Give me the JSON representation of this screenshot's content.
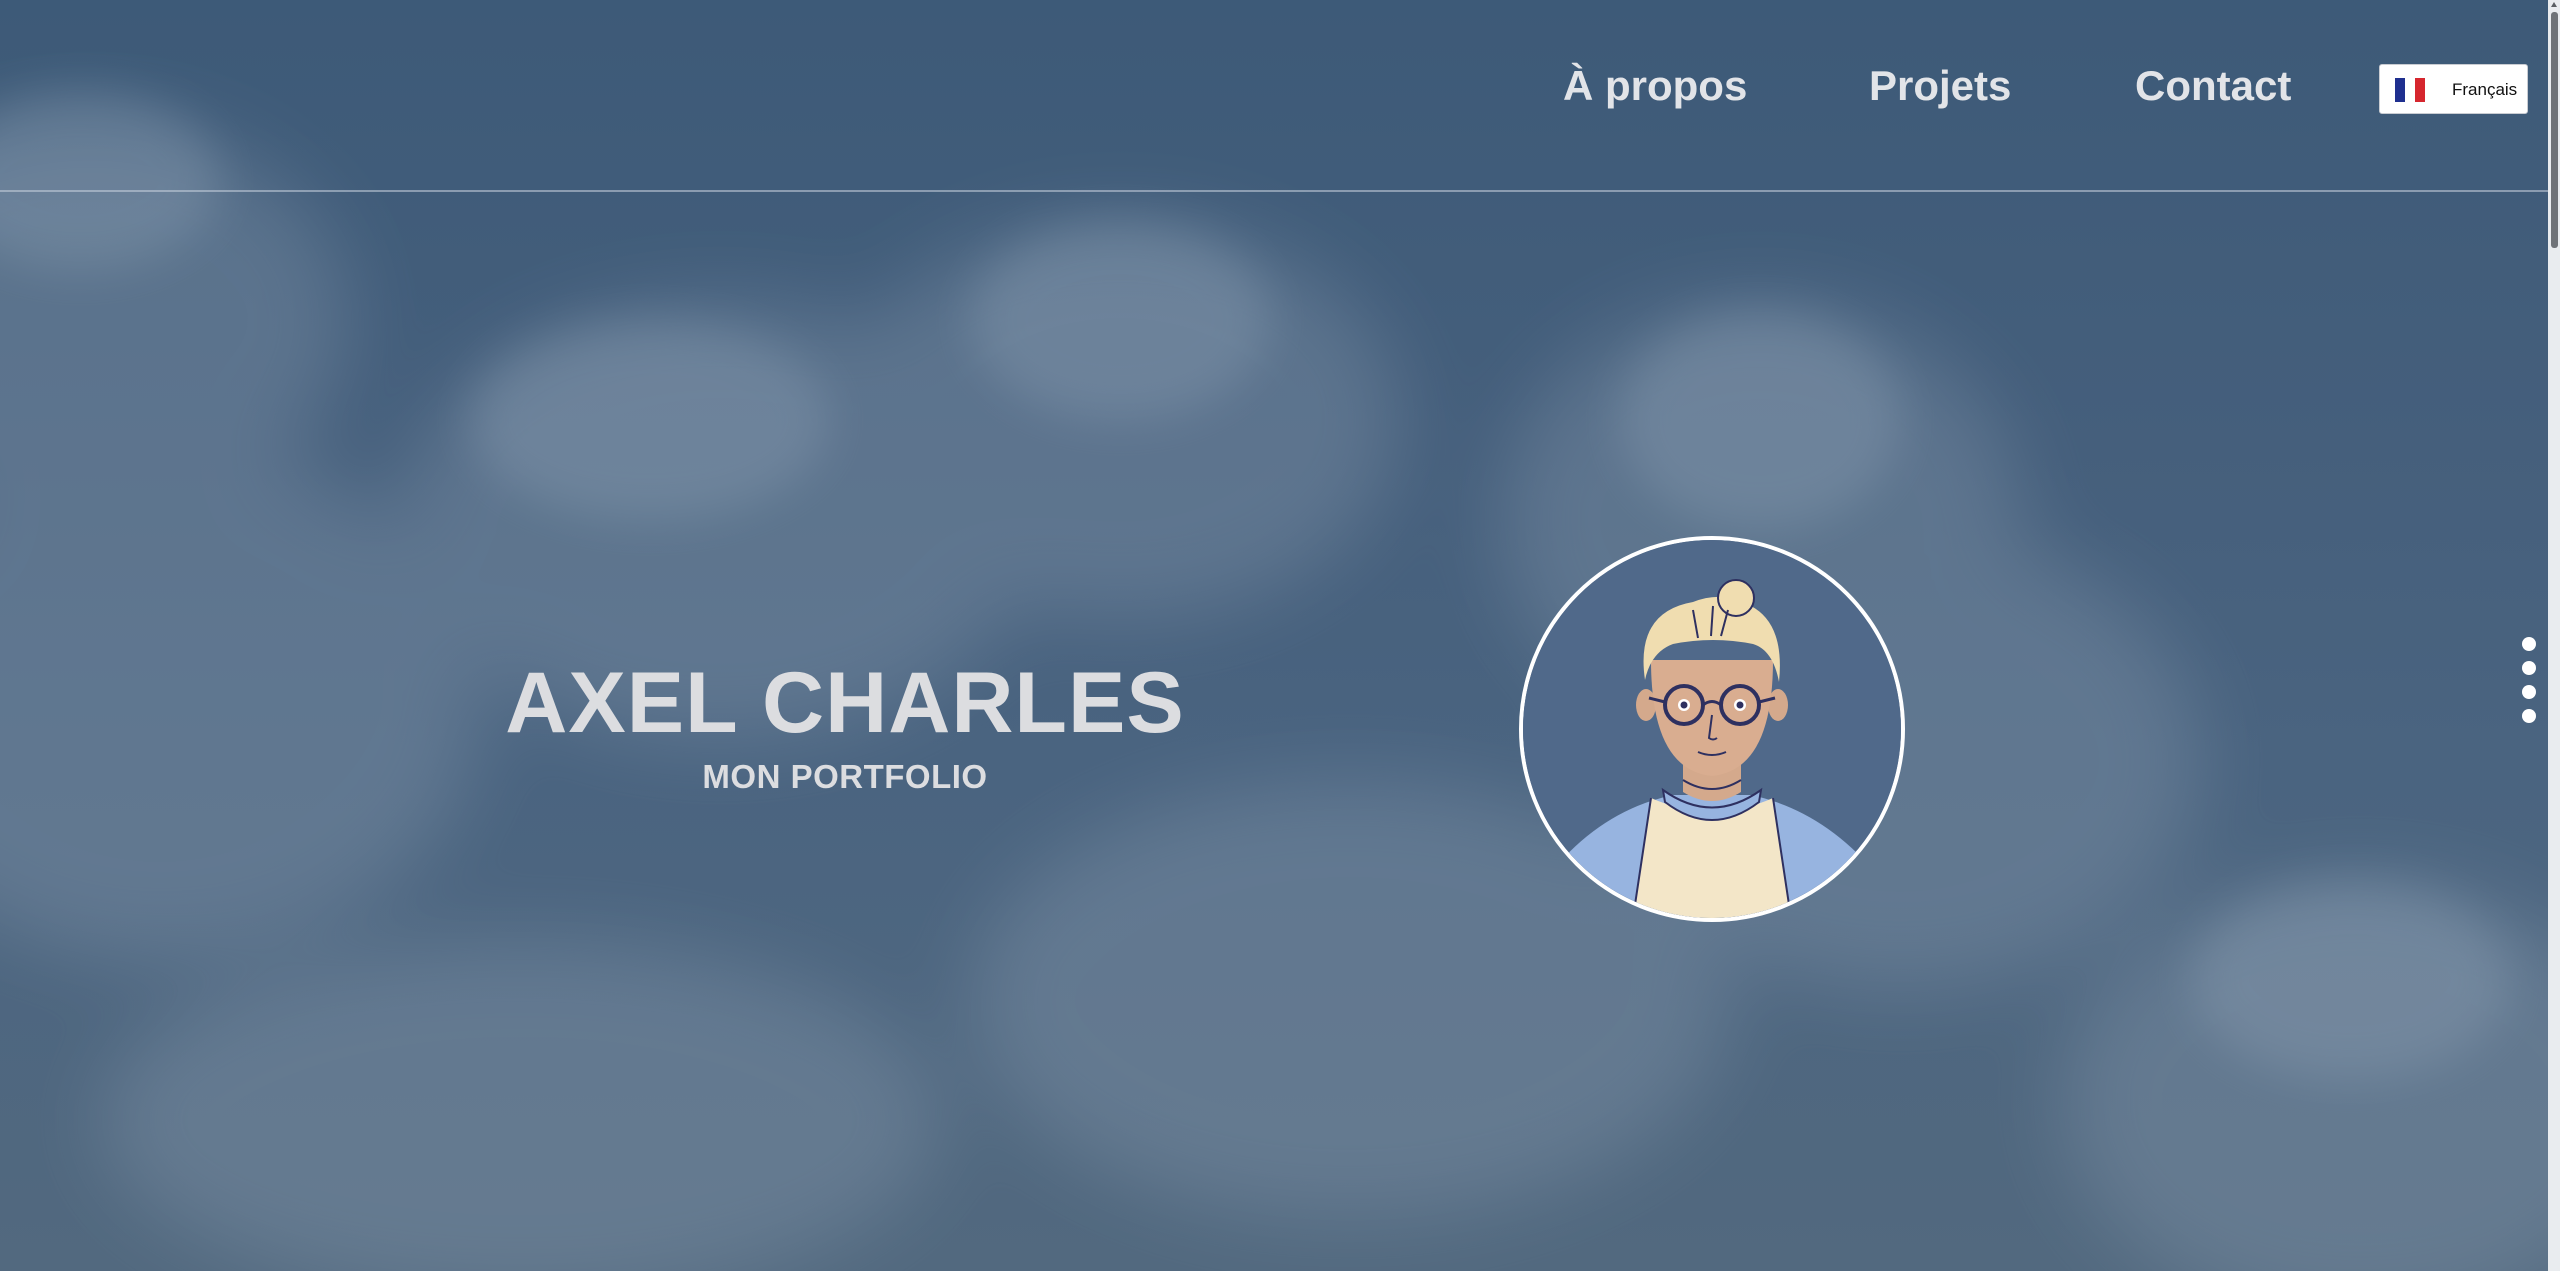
{
  "nav": {
    "about": "À propos",
    "projects": "Projets",
    "contact": "Contact"
  },
  "language": {
    "label": "Français",
    "flag_icon": "france-flag-icon",
    "flag_colors": [
      "#1f2f8f",
      "#ffffff",
      "#d6262e"
    ]
  },
  "hero": {
    "name": "AXEL CHARLES",
    "subtitle": "MON PORTFOLIO"
  },
  "section_dots": [
    {
      "name": "section-dot-1"
    },
    {
      "name": "section-dot-2"
    },
    {
      "name": "section-dot-3"
    },
    {
      "name": "section-dot-4"
    }
  ],
  "colors": {
    "background": "#455f7c",
    "text": "#dcdde0",
    "avatar_border": "#ffffff"
  }
}
